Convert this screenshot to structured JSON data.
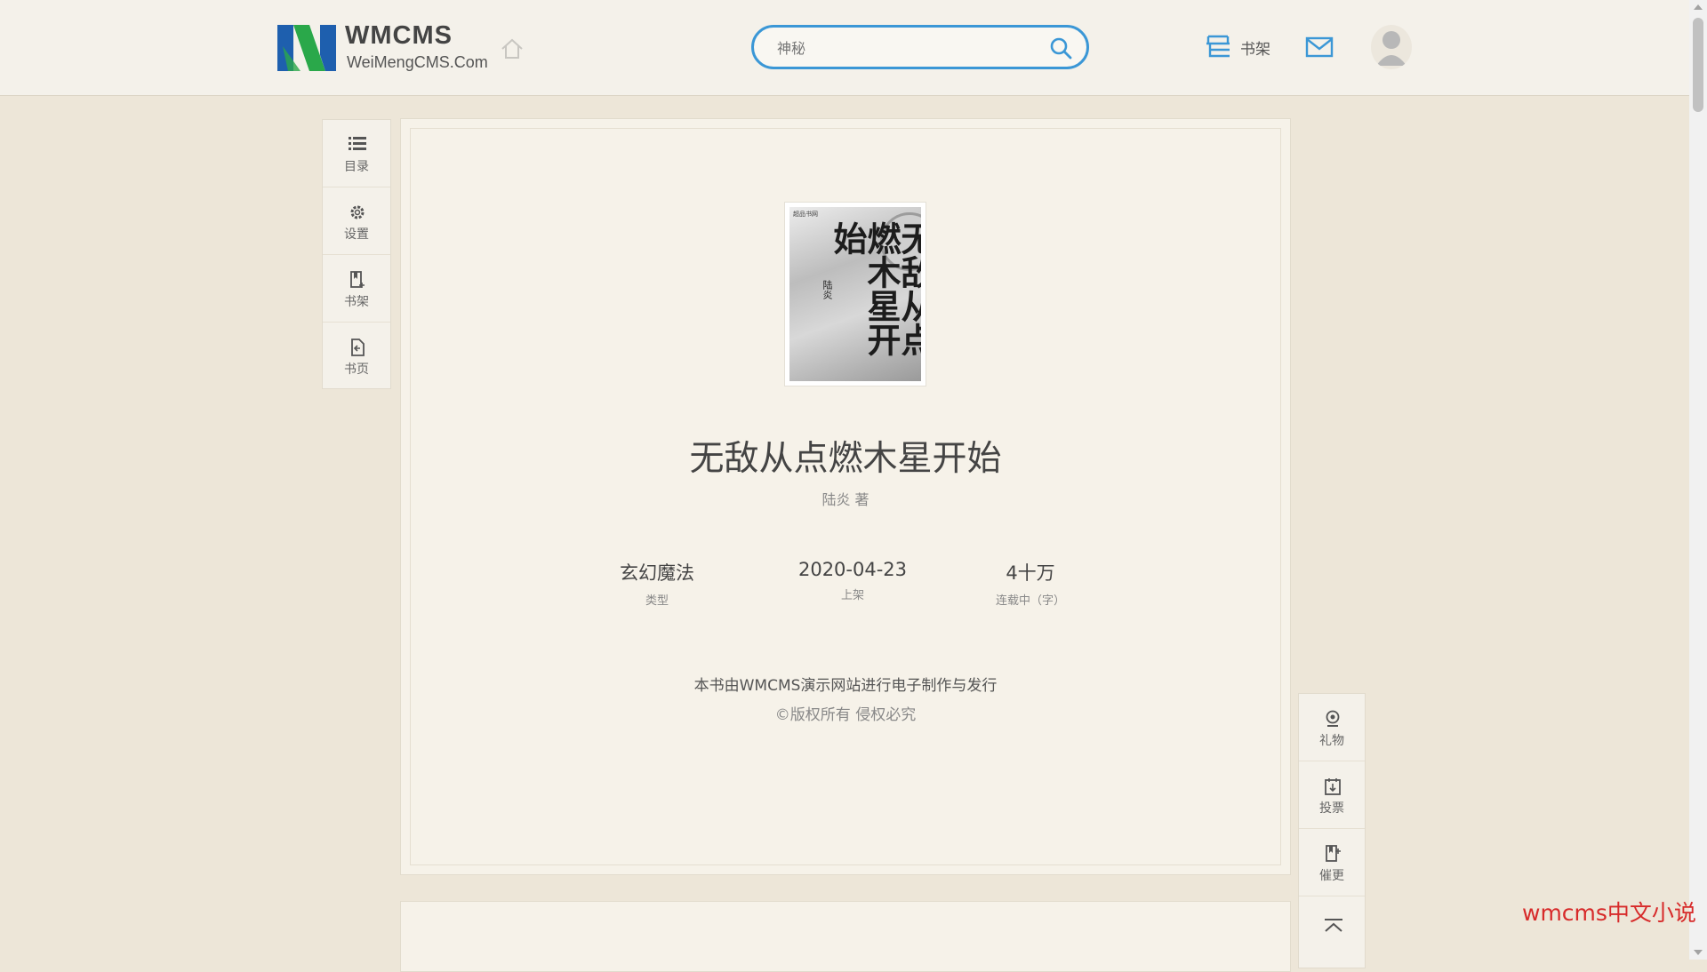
{
  "header": {
    "logo_brand": "WMCMS",
    "logo_url": "WeiMengCMS.Com",
    "search_placeholder": "神秘",
    "shelf_label": "书架"
  },
  "left_toolbar": [
    {
      "label": "目录",
      "icon": "list-icon"
    },
    {
      "label": "设置",
      "icon": "gear-icon"
    },
    {
      "label": "书架",
      "icon": "bookmark-icon"
    },
    {
      "label": "书页",
      "icon": "page-return-icon"
    }
  ],
  "book": {
    "cover": {
      "title": "无敌从点燃木星开始",
      "author": "陆炎",
      "publisher_mark": "超品书网"
    },
    "title": "无敌从点燃木星开始",
    "author_line": "陆炎 著",
    "stats": [
      {
        "value": "玄幻魔法",
        "caption": "类型"
      },
      {
        "value": "2020-04-23",
        "caption": "上架"
      },
      {
        "value": "4十万",
        "caption": "连载中（字）"
      }
    ],
    "publish_note": "本书由WMCMS演示网站进行电子制作与发行",
    "copyright": "©版权所有 侵权必究"
  },
  "right_toolbar": [
    {
      "label": "礼物",
      "icon": "gift-icon"
    },
    {
      "label": "投票",
      "icon": "vote-icon"
    },
    {
      "label": "催更",
      "icon": "urge-update-icon"
    },
    {
      "label": "",
      "icon": "back-to-top-icon"
    }
  ],
  "watermark": "wmcms中文小说",
  "colors": {
    "accent": "#3b97d6",
    "page_bg": "#ede6d8",
    "panel_bg": "#f6f2e9",
    "watermark": "#d72a2a"
  }
}
